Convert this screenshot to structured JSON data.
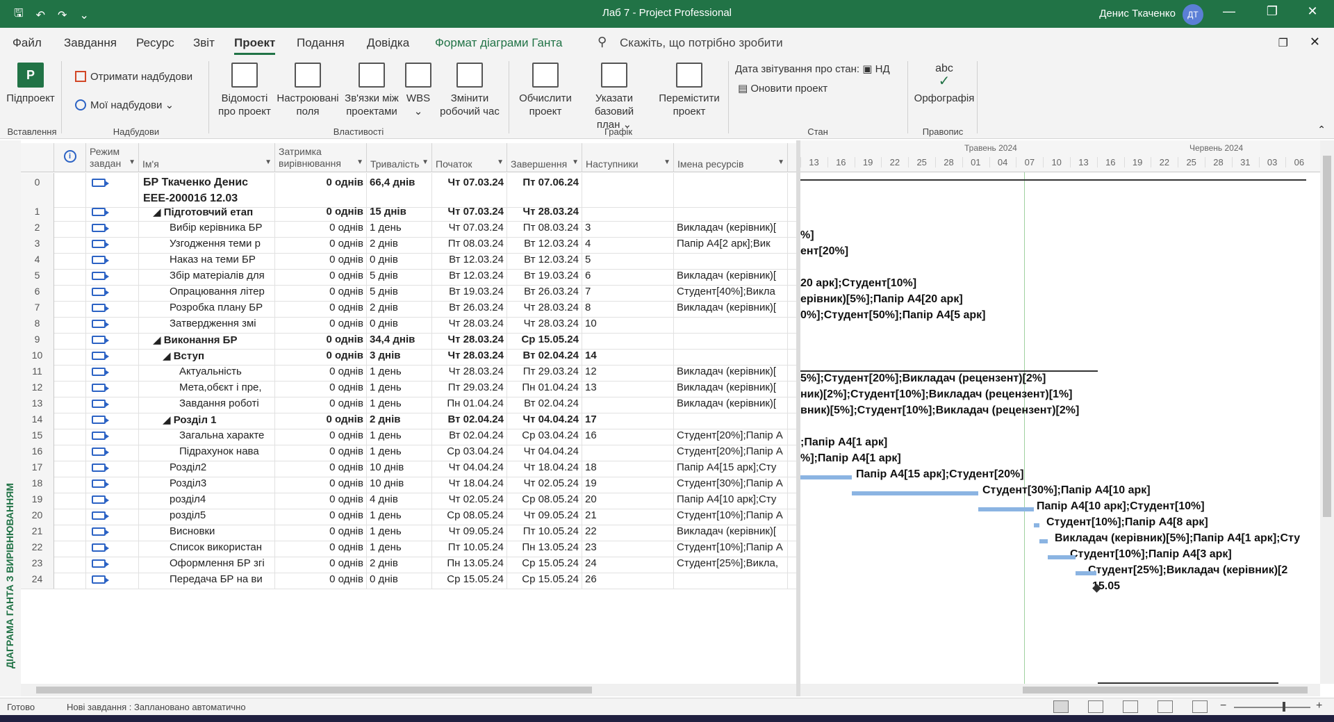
{
  "window": {
    "title": "Лаб 7  -  Project Professional",
    "user": "Денис Ткаченко",
    "avatar": "ДТ",
    "qat": [
      "save-icon",
      "undo-icon",
      "redo-icon",
      "customize-icon"
    ],
    "minimize": "—",
    "restore": "❐",
    "close": "✕"
  },
  "menu": {
    "tabs": [
      "Файл",
      "Завдання",
      "Ресурс",
      "Звіт",
      "Проект",
      "Подання",
      "Довідка",
      "Формат діаграми Ганта"
    ],
    "active": "Проект",
    "search": "Скажіть, що потрібно зробити"
  },
  "ribbon": {
    "subproject": "Підпроект",
    "get_addins": "Отримати надбудови",
    "my_addins": "Мої надбудови",
    "project_info": [
      "Відомості",
      "про проект"
    ],
    "custom_fields": [
      "Настроювані",
      "поля"
    ],
    "links": [
      "Зв'язки між",
      "проектами"
    ],
    "wbs": "WBS",
    "change_time": [
      "Змінити",
      "робочий час"
    ],
    "calc": [
      "Обчислити",
      "проект"
    ],
    "baseline": [
      "Указати базовий",
      "план ⌄"
    ],
    "move": [
      "Перемістити",
      "проект"
    ],
    "status_date_label": "Дата звітування про стан:",
    "status_date_value": "НД",
    "update": "Оновити проект",
    "spelling_abc": "abc",
    "spelling": "Орфографія",
    "groups": [
      "Вставлення",
      "Надбудови",
      "Властивості",
      "Графік",
      "Стан",
      "Правопис"
    ]
  },
  "side_label": "ДІАГРАМА ГАНТА З ВИРІВНЮВАННЯМ",
  "columns": {
    "mode": "Режим завдан",
    "name": "Ім'я",
    "delay": "Затримка вирівнювання",
    "duration": "Тривалість",
    "start": "Початок",
    "finish": "Завершення",
    "successors": "Наступники",
    "resources": "Імена ресурсів"
  },
  "rows": [
    {
      "id": "0",
      "name": "БР Ткаченко Денис ЕЕЕ-20001б 12.03",
      "delay": "0 однів",
      "dur": "66,4 днів",
      "start": "Чт 07.03.24",
      "finish": "Пт 07.06.24",
      "succ": "",
      "res": ""
    },
    {
      "id": "1",
      "name": "◢ Підготовчий етап",
      "delay": "0 однів",
      "dur": "15 днів",
      "start": "Чт 07.03.24",
      "finish": "Чт 28.03.24",
      "succ": "",
      "res": ""
    },
    {
      "id": "2",
      "name": "Вибір керівника БР",
      "delay": "0 однів",
      "dur": "1 день",
      "start": "Чт 07.03.24",
      "finish": "Пт 08.03.24",
      "succ": "3",
      "res": "Викладач (керівник)["
    },
    {
      "id": "3",
      "name": "Узгодження теми р",
      "delay": "0 однів",
      "dur": "2 днів",
      "start": "Пт 08.03.24",
      "finish": "Вт 12.03.24",
      "succ": "4",
      "res": "Папір А4[2 арк];Вик"
    },
    {
      "id": "4",
      "name": "Наказ на теми БР",
      "delay": "0 однів",
      "dur": "0 днів",
      "start": "Вт 12.03.24",
      "finish": "Вт 12.03.24",
      "succ": "5",
      "res": ""
    },
    {
      "id": "5",
      "name": "Збір матеріалів для",
      "delay": "0 однів",
      "dur": "5 днів",
      "start": "Вт 12.03.24",
      "finish": "Вт 19.03.24",
      "succ": "6",
      "res": "Викладач (керівник)["
    },
    {
      "id": "6",
      "name": "Опрацювання літер",
      "delay": "0 однів",
      "dur": "5 днів",
      "start": "Вт 19.03.24",
      "finish": "Вт 26.03.24",
      "succ": "7",
      "res": "Студент[40%];Викла"
    },
    {
      "id": "7",
      "name": "Розробка плану БР",
      "delay": "0 однів",
      "dur": "2 днів",
      "start": "Вт 26.03.24",
      "finish": "Чт 28.03.24",
      "succ": "8",
      "res": "Викладач (керівник)["
    },
    {
      "id": "8",
      "name": "Затвердження змі",
      "delay": "0 однів",
      "dur": "0 днів",
      "start": "Чт 28.03.24",
      "finish": "Чт 28.03.24",
      "succ": "10",
      "res": ""
    },
    {
      "id": "9",
      "name": "◢ Виконання БР",
      "delay": "0 однів",
      "dur": "34,4 днів",
      "start": "Чт 28.03.24",
      "finish": "Ср 15.05.24",
      "succ": "",
      "res": ""
    },
    {
      "id": "10",
      "name": "◢ Вступ",
      "delay": "0 однів",
      "dur": "3 днів",
      "start": "Чт 28.03.24",
      "finish": "Вт 02.04.24",
      "succ": "14",
      "res": ""
    },
    {
      "id": "11",
      "name": "Актуальність",
      "delay": "0 однів",
      "dur": "1 день",
      "start": "Чт 28.03.24",
      "finish": "Пт 29.03.24",
      "succ": "12",
      "res": "Викладач (керівник)["
    },
    {
      "id": "12",
      "name": "Мета,обєкт і пре,",
      "delay": "0 однів",
      "dur": "1 день",
      "start": "Пт 29.03.24",
      "finish": "Пн 01.04.24",
      "succ": "13",
      "res": "Викладач (керівник)["
    },
    {
      "id": "13",
      "name": "Завдання роботі",
      "delay": "0 однів",
      "dur": "1 день",
      "start": "Пн 01.04.24",
      "finish": "Вт 02.04.24",
      "succ": "",
      "res": "Викладач (керівник)["
    },
    {
      "id": "14",
      "name": "◢ Розділ 1",
      "delay": "0 однів",
      "dur": "2 днів",
      "start": "Вт 02.04.24",
      "finish": "Чт 04.04.24",
      "succ": "17",
      "res": ""
    },
    {
      "id": "15",
      "name": "Загальна характе",
      "delay": "0 однів",
      "dur": "1 день",
      "start": "Вт 02.04.24",
      "finish": "Ср 03.04.24",
      "succ": "16",
      "res": "Студент[20%];Папір А"
    },
    {
      "id": "16",
      "name": "Підрахунок нава",
      "delay": "0 однів",
      "dur": "1 день",
      "start": "Ср 03.04.24",
      "finish": "Чт 04.04.24",
      "succ": "",
      "res": "Студент[20%];Папір А"
    },
    {
      "id": "17",
      "name": "Розділ2",
      "delay": "0 однів",
      "dur": "10 днів",
      "start": "Чт 04.04.24",
      "finish": "Чт 18.04.24",
      "succ": "18",
      "res": "Папір А4[15 арк];Сту"
    },
    {
      "id": "18",
      "name": "Розділ3",
      "delay": "0 однів",
      "dur": "10 днів",
      "start": "Чт 18.04.24",
      "finish": "Чт 02.05.24",
      "succ": "19",
      "res": "Студент[30%];Папір А"
    },
    {
      "id": "19",
      "name": "розділ4",
      "delay": "0 однів",
      "dur": "4 днів",
      "start": "Чт 02.05.24",
      "finish": "Ср 08.05.24",
      "succ": "20",
      "res": "Папір А4[10 арк];Сту"
    },
    {
      "id": "20",
      "name": "розділ5",
      "delay": "0 однів",
      "dur": "1 день",
      "start": "Ср 08.05.24",
      "finish": "Чт 09.05.24",
      "succ": "21",
      "res": "Студент[10%];Папір А"
    },
    {
      "id": "21",
      "name": "Висновки",
      "delay": "0 однів",
      "dur": "1 день",
      "start": "Чт 09.05.24",
      "finish": "Пт 10.05.24",
      "succ": "22",
      "res": "Викладач (керівник)["
    },
    {
      "id": "22",
      "name": "Список використан",
      "delay": "0 однів",
      "dur": "1 день",
      "start": "Пт 10.05.24",
      "finish": "Пн 13.05.24",
      "succ": "23",
      "res": "Студент[10%];Папір А"
    },
    {
      "id": "23",
      "name": "Оформлення БР згі",
      "delay": "0 однів",
      "dur": "2 днів",
      "start": "Пн 13.05.24",
      "finish": "Ср 15.05.24",
      "succ": "24",
      "res": "Студент[25%];Викла,"
    },
    {
      "id": "24",
      "name": "Передача БР на ви",
      "delay": "0 однів",
      "dur": "0 днів",
      "start": "Ср 15.05.24",
      "finish": "Ср 15.05.24",
      "succ": "26",
      "res": ""
    }
  ],
  "gantt": {
    "months": [
      "Травень 2024",
      "Червень 2024"
    ],
    "days": [
      "13",
      "16",
      "19",
      "22",
      "25",
      "28",
      "01",
      "04",
      "07",
      "10",
      "13",
      "16",
      "19",
      "22",
      "25",
      "28",
      "31",
      "03",
      "06"
    ],
    "labels": [
      "%]",
      "ент[20%]",
      "20 арк];Студент[10%]",
      "ерівник)[5%];Папір А4[20 арк]",
      "0%];Студент[50%];Папір А4[5 арк]",
      "5%];Студент[20%];Викладач (рецензент)[2%]",
      "ник)[2%];Студент[10%];Викладач (рецензент)[1%]",
      "вник)[5%];Студент[10%];Викладач (рецензент)[2%]",
      ";Папір А4[1 арк]",
      "%];Папір А4[1 арк]",
      "Папір А4[15 арк];Студент[20%]",
      "Студент[30%];Папір А4[10 арк]",
      "Папір А4[10 арк];Студент[10%]",
      "Студент[10%];Папір А4[8 арк]",
      "Викладач (керівник)[5%];Папір А4[1 арк];Сту",
      "Студент[10%];Папір А4[3 арк]",
      "Студент[25%];Викладач (керівник)[2",
      "15.05"
    ]
  },
  "status": {
    "ready": "Готово",
    "new_tasks": "Нові завдання : Заплановано автоматично"
  }
}
